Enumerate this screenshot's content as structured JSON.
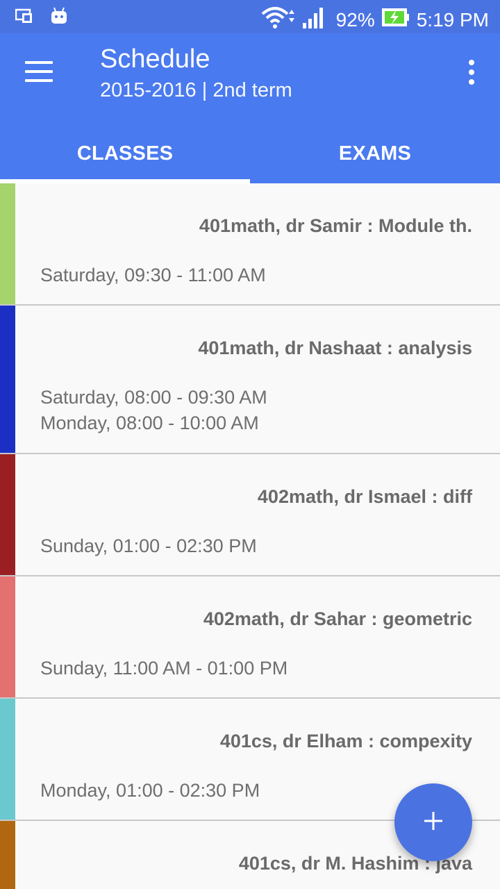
{
  "status_bar": {
    "battery_percent": "92%",
    "time": "5:19 PM",
    "icons": [
      "screen-cast-icon",
      "android-icon",
      "wifi-icon",
      "signal-icon",
      "battery-charging-icon"
    ]
  },
  "app_bar": {
    "title": "Schedule",
    "subtitle": "2015-2016 | 2nd term",
    "menu_icon": "hamburger-menu-icon",
    "overflow_icon": "more-vert-icon"
  },
  "tabs": [
    {
      "label": "CLASSES",
      "active": true
    },
    {
      "label": "EXAMS",
      "active": false
    }
  ],
  "classes": [
    {
      "title": "401math, dr Samir : Module th.",
      "color": "#a5d36c",
      "times": [
        "Saturday, 09:30 - 11:00 AM"
      ]
    },
    {
      "title": "401math, dr Nashaat : analysis",
      "color": "#1c2fc4",
      "times": [
        "Saturday, 08:00 - 09:30 AM",
        "Monday, 08:00 - 10:00 AM"
      ]
    },
    {
      "title": "402math, dr Ismael : diff",
      "color": "#9a1f22",
      "times": [
        "Sunday, 01:00 - 02:30 PM"
      ]
    },
    {
      "title": "402math, dr Sahar : geometric",
      "color": "#e47070",
      "times": [
        "Sunday, 11:00 AM - 01:00 PM"
      ]
    },
    {
      "title": "401cs, dr Elham : compexity",
      "color": "#6ac9cf",
      "times": [
        "Monday, 01:00 - 02:30 PM"
      ]
    },
    {
      "title": "401cs, dr M. Hashim : java",
      "color": "#b0670f",
      "times": []
    }
  ],
  "fab": {
    "icon": "add-icon",
    "color": "#4a72e0"
  }
}
